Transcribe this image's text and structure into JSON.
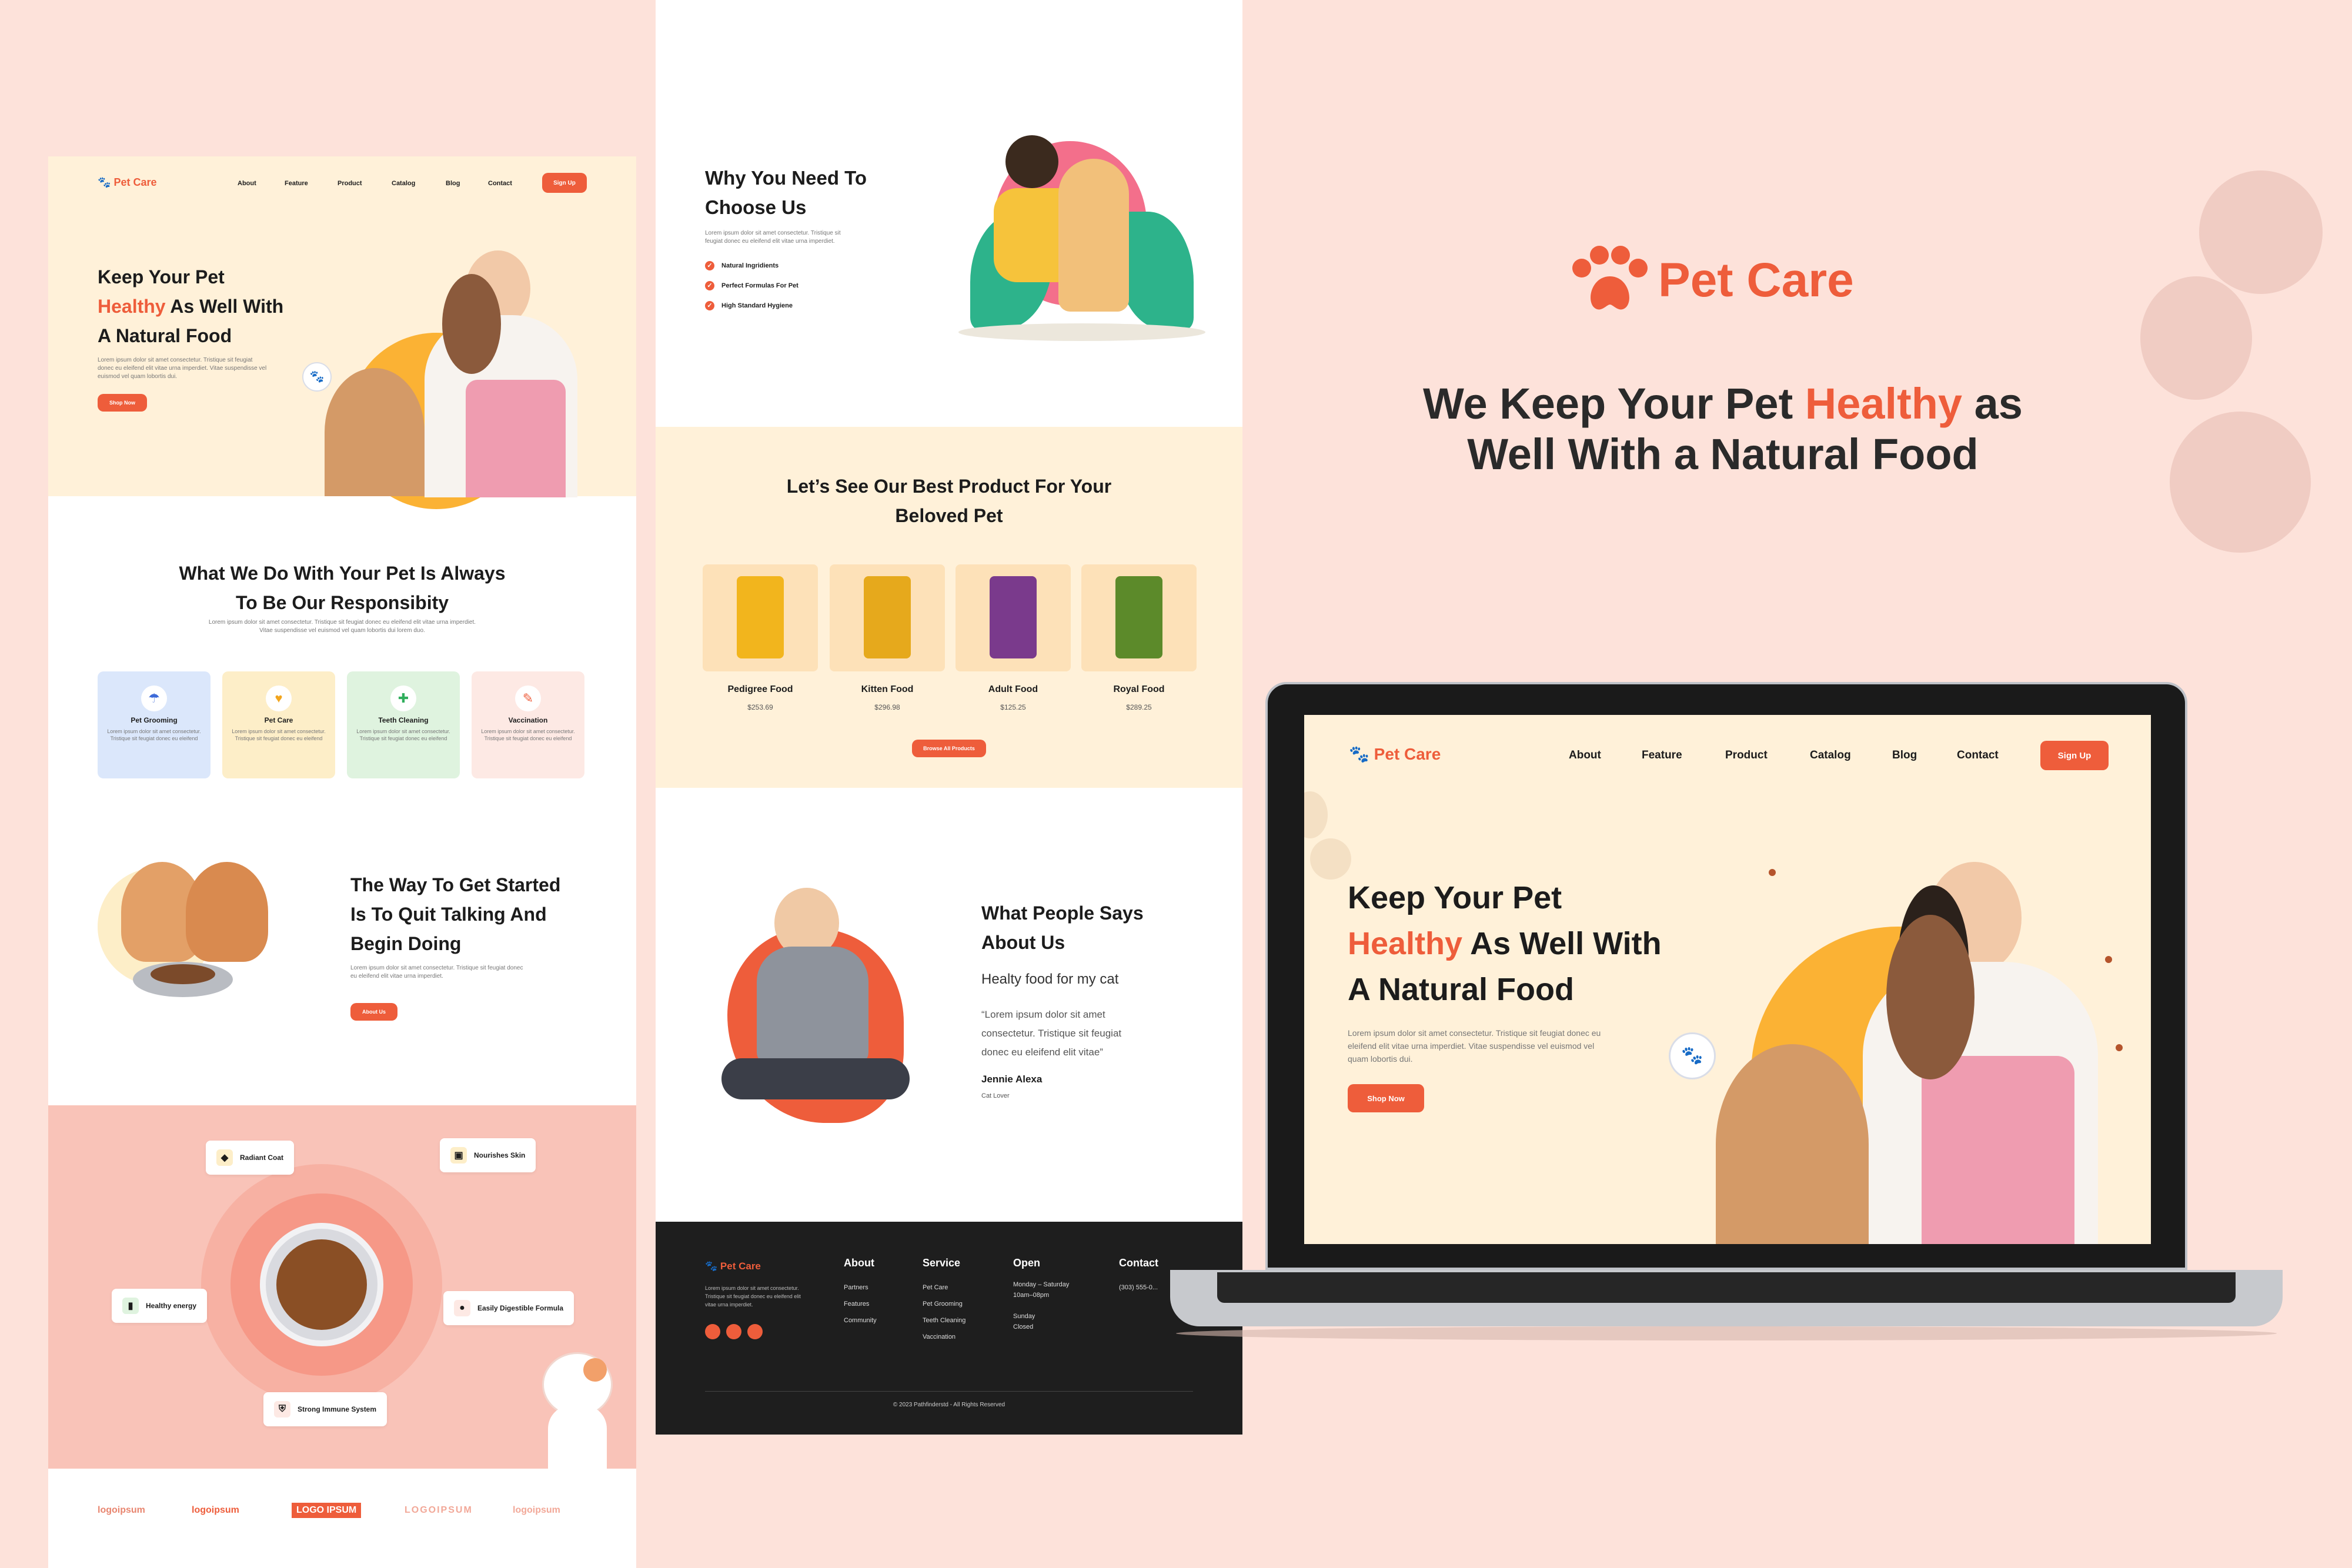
{
  "brand": {
    "name": "Pet Care"
  },
  "colors": {
    "accent": "#ee5d3b",
    "background": "#fde2da",
    "cream": "#fff1d9",
    "dark": "#1e1e1e"
  },
  "showcase": {
    "headline_pre": "We Keep Your Pet",
    "headline_accent": "Healthy",
    "headline_post": "as",
    "headline_line2": "Well With a Natural Food"
  },
  "nav": {
    "items": [
      "About",
      "Feature",
      "Product",
      "Catalog",
      "Blog",
      "Contact"
    ],
    "signup": "Sign Up"
  },
  "hero": {
    "line1": "Keep Your Pet",
    "accent": "Healthy",
    "line2_rest": "As Well With",
    "line3": "A Natural Food",
    "body": "Lorem ipsum dolor sit amet consectetur. Tristique sit feugiat donec eu eleifend elit vitae urna imperdiet. Vitae suspendisse vel euismod vel quam lobortis dui.",
    "cta": "Shop Now"
  },
  "services": {
    "title_line1": "What We Do With Your Pet Is Always",
    "title_line2": "To Be Our Responsibity",
    "subtitle": "Lorem ipsum dolor sit amet consectetur. Tristique sit feugiat donec eu eleifend elit vitae urna imperdiet. Vitae suspendisse vel euismod vel quam lobortis dui lorem duo.",
    "cards": [
      {
        "title": "Pet Grooming",
        "desc": "Lorem ipsum dolor sit amet consectetur. Tristique sit feugiat donec eu eleifend",
        "icon": "shower-icon",
        "glyph": "🚿",
        "bg": "#dbe7fb"
      },
      {
        "title": "Pet Care",
        "desc": "Lorem ipsum dolor sit amet consectetur. Tristique sit feugiat donec eu eleifend",
        "icon": "heart-paw-icon",
        "glyph": "♥",
        "bg": "#fdeec8"
      },
      {
        "title": "Teeth Cleaning",
        "desc": "Lorem ipsum dolor sit amet consectetur. Tristique sit feugiat donec eu eleifend",
        "icon": "tooth-icon",
        "glyph": "🦷",
        "bg": "#dff3df"
      },
      {
        "title": "Vaccination",
        "desc": "Lorem ipsum dolor sit amet consectetur. Tristique sit feugiat donec eu eleifend",
        "icon": "syringe-icon",
        "glyph": "💉",
        "bg": "#fde9e4"
      }
    ]
  },
  "getstarted": {
    "line1": "The Way To Get Started",
    "line2": "Is To Quit Talking And",
    "line3": "Begin Doing",
    "body": "Lorem ipsum dolor sit amet consectetur. Tristique sit feugiat donec eu eleifend elit vitae urna imperdiet.",
    "cta": "About Us"
  },
  "benefits": [
    "Radiant Coat",
    "Nourishes Skin",
    "Healthy energy",
    "Easily Digestible Formula",
    "Strong Immune System"
  ],
  "logos": [
    "logoipsum",
    "logoipsum",
    "LOGO IPSUM",
    "LOGOIPSUM",
    "logoipsum"
  ],
  "why": {
    "title_line1": "Why You Need To",
    "title_line2": "Choose Us",
    "body": "Lorem ipsum dolor sit amet consectetur. Tristique sit feugiat donec eu eleifend elit vitae urna imperdiet.",
    "points": [
      "Natural Ingridients",
      "Perfect Formulas For Pet",
      "High Standard Hygiene"
    ]
  },
  "products": {
    "title_line1": "Let’s See Our Best Product For Your",
    "title_line2": "Beloved Pet",
    "items": [
      {
        "name": "Pedigree Food",
        "price": "$253.69",
        "color": "#f2b51d"
      },
      {
        "name": "Kitten Food",
        "price": "$296.98",
        "color": "#e6a91c"
      },
      {
        "name": "Adult Food",
        "price": "$125.25",
        "color": "#7a3a8c"
      },
      {
        "name": "Royal Food",
        "price": "$289.25",
        "color": "#5c8a2a"
      }
    ],
    "cta": "Browse All Products"
  },
  "testimonial": {
    "title_line1": "What People Says",
    "title_line2": "About Us",
    "heading": "Healty food for my cat",
    "quote_l1": "“Lorem ipsum dolor sit amet",
    "quote_l2": "consectetur. Tristique sit feugiat",
    "quote_l3": "donec eu eleifend elit vitae”",
    "name": "Jennie Alexa",
    "role": "Cat Lover"
  },
  "footer": {
    "desc": "Lorem ipsum dolor sit amet consectetur. Tristique sit feugiat donec eu eleifend elit vitae urna imperdiet.",
    "about_h": "About",
    "about": [
      "Partners",
      "Features",
      "Community"
    ],
    "service_h": "Service",
    "service": [
      "Pet Care",
      "Pet Grooming",
      "Teeth Cleaning",
      "Vaccination"
    ],
    "open_h": "Open",
    "open_l1": "Monday – Saturday",
    "open_l2": "10am–08pm",
    "open_l3": "Sunday",
    "open_l4": "Closed",
    "contact_h": "Contact",
    "contact_phone": "(303) 555-0...",
    "copyright": "© 2023 Pathfinderstd - All Rights Reserved"
  }
}
